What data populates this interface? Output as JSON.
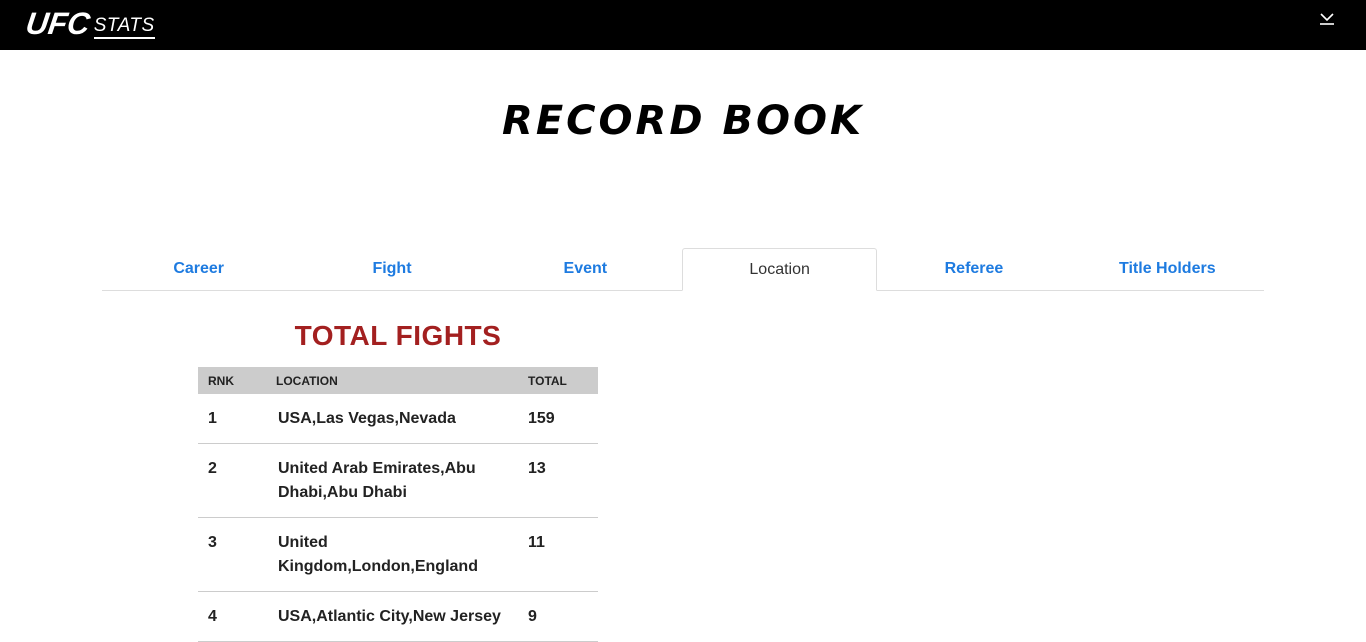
{
  "header": {
    "logo_main": "UFC",
    "logo_sub": "STATS",
    "menu_icon": "chevron-down-icon"
  },
  "page": {
    "title": "RECORD BOOK"
  },
  "tabs": [
    {
      "label": "Career",
      "active": false
    },
    {
      "label": "Fight",
      "active": false
    },
    {
      "label": "Event",
      "active": false
    },
    {
      "label": "Location",
      "active": true
    },
    {
      "label": "Referee",
      "active": false
    },
    {
      "label": "Title Holders",
      "active": false
    }
  ],
  "section": {
    "title": "TOTAL FIGHTS",
    "columns": {
      "rank": "RNK",
      "location": "LOCATION",
      "total": "TOTAL"
    },
    "rows": [
      {
        "rank": "1",
        "location": "USA,Las Vegas,Nevada",
        "total": "159"
      },
      {
        "rank": "2",
        "location": "United Arab Emirates,Abu Dhabi,Abu Dhabi",
        "total": "13"
      },
      {
        "rank": "3",
        "location": "United Kingdom,London,England",
        "total": "11"
      },
      {
        "rank": "4",
        "location": "USA,Atlantic City,New Jersey",
        "total": "9"
      }
    ]
  },
  "colors": {
    "topbar": "#000000",
    "tab_link": "#1e7be0",
    "section_title": "#a32020",
    "table_header": "#cccccc"
  }
}
